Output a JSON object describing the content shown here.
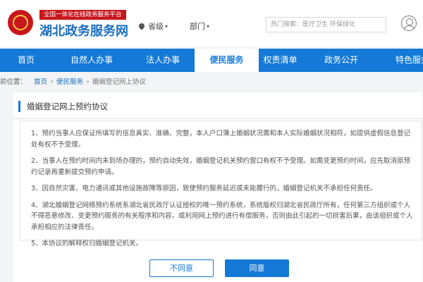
{
  "header": {
    "tagline": "全国一体化在线政务服务平台",
    "site_title": "湖北政务服务网",
    "province": "省级",
    "department": "部门",
    "search_placeholder": "热门搜索：医疗卫生 环保绿化"
  },
  "nav": {
    "items": [
      "首页",
      "自然人办事",
      "法人办事",
      "便民服务",
      "权责清单",
      "政务公开",
      "特色服务"
    ],
    "active_index": 3
  },
  "breadcrumb": {
    "prefix": "前位置：",
    "items": [
      "首页",
      "便民服务",
      "婚姻登记网上协议"
    ]
  },
  "agreement": {
    "title": "婚姻登记网上预约协议",
    "clauses": [
      "1、预约当事人应保证所填写的信息真实、准确、完整，本人户口簿上婚姻状况需和本人实际婚姻状况相符，如提供虚假信息登记处有权不予受理。",
      "2、当事人在预约时间内未到场办理的，预约自动失效，婚姻登记机关预约窗口有权不予受理。如需变更预约时间，应先取消原预约记录再重新提交预约申请。",
      "3、因自然灾害、电力通讯或其他设施故障等原因，致使预约服务延迟或未能履行的，婚姻登记机关不承担任何责任。",
      "4、湖北婚姻登记网络预约系统系湖北省民政厅认证授权的唯一预约系统，系统版权归湖北省民政厅所有，任何第三方组织或个人不得恶意修改、变更预约服务的有关程序和内容，或利用网上预约进行有偿服务，否则由此引起的一切损害后果，由该组织或个人承担相应的法律责任。",
      "5、本协议的解释权归婚姻登记机关。"
    ],
    "disagree_label": "不同意",
    "agree_label": "同意"
  },
  "colors": {
    "brand_blue": "#1479d7",
    "brand_red": "#c8161d"
  }
}
